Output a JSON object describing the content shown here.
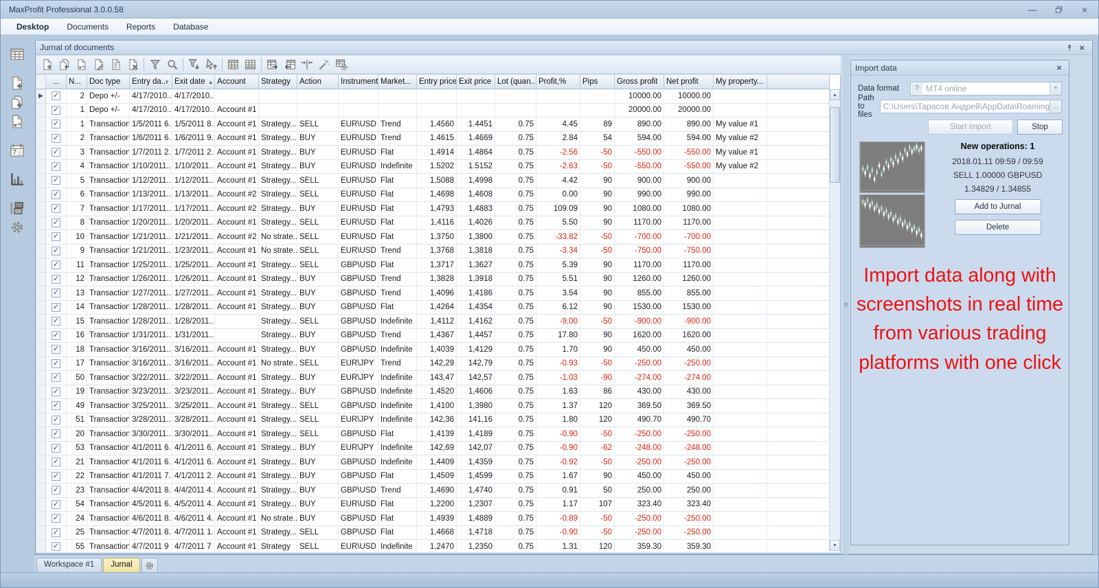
{
  "window": {
    "title": "MaxProfit Professional 3.0.0.58"
  },
  "menu": {
    "items": [
      "Desktop",
      "Documents",
      "Reports",
      "Database"
    ]
  },
  "sidebar": {
    "icons": [
      "journal-grid-icon",
      "new-document-icon",
      "copy-documents-icon",
      "transfer-documents-icon",
      "calendar-icon",
      "statistics-icon",
      "database-icon",
      "settings-icon"
    ]
  },
  "panel": {
    "title": "Jurnal of documents"
  },
  "toolbar": {
    "icons": [
      "add-document-icon",
      "copy-document-icon",
      "transfer-document-icon",
      "edit-document-icon",
      "view-document-icon",
      "delete-document-icon",
      "|",
      "filter-icon",
      "search-icon",
      "|",
      "filter-export-icon",
      "pointer-import-icon",
      "|",
      "group-table-icon",
      "summary-table-icon",
      "|",
      "export-table-icon",
      "import-table-icon",
      "best-fit-columns-icon",
      "wizard-icon",
      "grid-settings-icon"
    ]
  },
  "grid": {
    "columns": [
      {
        "label": "...",
        "align": "center"
      },
      {
        "label": "N...",
        "align": "right"
      },
      {
        "label": "Doc type",
        "align": "left"
      },
      {
        "label": "Entry da...",
        "align": "left",
        "filter": true
      },
      {
        "label": "Exit date",
        "align": "left",
        "sort": "asc"
      },
      {
        "label": "Account",
        "align": "left"
      },
      {
        "label": "Strategy",
        "align": "left"
      },
      {
        "label": "Action",
        "align": "left"
      },
      {
        "label": "Instrument",
        "align": "left"
      },
      {
        "label": "Market...",
        "align": "left"
      },
      {
        "label": "Entry price",
        "align": "right"
      },
      {
        "label": "Exit price",
        "align": "right"
      },
      {
        "label": "Lot (quan...",
        "align": "right"
      },
      {
        "label": "Profit,%",
        "align": "right"
      },
      {
        "label": "Pips",
        "align": "right"
      },
      {
        "label": "Gross profit",
        "align": "right"
      },
      {
        "label": "Net profit",
        "align": "right"
      },
      {
        "label": "My property...",
        "align": "left"
      }
    ],
    "rows": [
      [
        "2",
        "Depo +/-",
        "4/17/2010...",
        "4/17/2010...",
        "",
        "",
        "",
        "",
        "",
        "",
        "",
        "",
        "",
        "",
        "10000.00",
        "10000.00",
        ""
      ],
      [
        "1",
        "Depo +/-",
        "4/17/2010...",
        "4/17/2010...",
        "Account #1",
        "",
        "",
        "",
        "",
        "",
        "",
        "",
        "",
        "",
        "20000.00",
        "20000.00",
        ""
      ],
      [
        "1",
        "Transaction",
        "1/5/2011 6...",
        "1/5/2011 8...",
        "Account #1",
        "Strategy...",
        "SELL",
        "EUR\\USD",
        "Trend",
        "1.4560",
        "1.4451",
        "0.75",
        "4.45",
        "89",
        "890.00",
        "890.00",
        "My value #1"
      ],
      [
        "2",
        "Transaction",
        "1/6/2011 6...",
        "1/6/2011 9...",
        "Account #1",
        "Strategy...",
        "BUY",
        "EUR\\USD",
        "Trend",
        "1.4615",
        "1.4669",
        "0.75",
        "2.84",
        "54",
        "594.00",
        "594.00",
        "My value #2"
      ],
      [
        "3",
        "Transaction",
        "1/7/2011 2...",
        "1/7/2011 2...",
        "Account #1",
        "Strategy...",
        "BUY",
        "EUR\\USD",
        "Flat",
        "1.4914",
        "1.4864",
        "0.75",
        "-2.56",
        "-50",
        "-550.00",
        "-550.00",
        "My value #1"
      ],
      [
        "4",
        "Transaction",
        "1/10/2011...",
        "1/10/2011...",
        "Account #1",
        "Strategy...",
        "BUY",
        "EUR\\USD",
        "Indefinite",
        "1.5202",
        "1.5152",
        "0.75",
        "-2.63",
        "-50",
        "-550.00",
        "-550.00",
        "My value #2"
      ],
      [
        "5",
        "Transaction",
        "1/12/2011...",
        "1/12/2011...",
        "Account #1",
        "Strategy...",
        "SELL",
        "EUR\\USD",
        "Flat",
        "1,5088",
        "1,4998",
        "0.75",
        "4.42",
        "90",
        "900.00",
        "900.00",
        ""
      ],
      [
        "6",
        "Transaction",
        "1/13/2011...",
        "1/13/2011...",
        "Account #2",
        "Strategy...",
        "SELL",
        "EUR\\USD",
        "Flat",
        "1,4698",
        "1,4608",
        "0.75",
        "0.00",
        "90",
        "990.00",
        "990.00",
        ""
      ],
      [
        "7",
        "Transaction",
        "1/17/2011...",
        "1/17/2011...",
        "Account #2",
        "Strategy...",
        "BUY",
        "EUR\\USD",
        "Flat",
        "1,4793",
        "1,4883",
        "0.75",
        "109.09",
        "90",
        "1080.00",
        "1080.00",
        ""
      ],
      [
        "8",
        "Transaction",
        "1/20/2011...",
        "1/20/2011...",
        "Account #1",
        "Strategy...",
        "SELL",
        "EUR\\USD",
        "Flat",
        "1,4116",
        "1,4026",
        "0.75",
        "5.50",
        "90",
        "1170.00",
        "1170.00",
        ""
      ],
      [
        "10",
        "Transaction",
        "1/21/2011...",
        "1/21/2011...",
        "Account #2",
        "No strate...",
        "SELL",
        "EUR\\USD",
        "Flat",
        "1,3750",
        "1,3800",
        "0.75",
        "-33.82",
        "-50",
        "-700.00",
        "-700.00",
        ""
      ],
      [
        "9",
        "Transaction",
        "1/21/2011...",
        "1/23/2011...",
        "Account #1",
        "No strate...",
        "SELL",
        "EUR\\USD",
        "Trend",
        "1,3768",
        "1,3818",
        "0.75",
        "-3.34",
        "-50",
        "-750.00",
        "-750.00",
        ""
      ],
      [
        "11",
        "Transaction",
        "1/25/2011...",
        "1/25/2011...",
        "Account #1",
        "Strategy...",
        "SELL",
        "GBP\\USD",
        "Flat",
        "1,3717",
        "1,3627",
        "0.75",
        "5.39",
        "90",
        "1170.00",
        "1170.00",
        ""
      ],
      [
        "12",
        "Transaction",
        "1/26/2011...",
        "1/26/2011...",
        "Account #1",
        "Strategy...",
        "BUY",
        "GBP\\USD",
        "Trend",
        "1,3828",
        "1,3918",
        "0.75",
        "5.51",
        "90",
        "1260.00",
        "1260.00",
        ""
      ],
      [
        "13",
        "Transaction",
        "1/27/2011...",
        "1/27/2011...",
        "Account #1",
        "Strategy...",
        "BUY",
        "GBP\\USD",
        "Trend",
        "1,4096",
        "1,4186",
        "0.75",
        "3.54",
        "90",
        "855.00",
        "855.00",
        ""
      ],
      [
        "14",
        "Transaction",
        "1/28/2011...",
        "1/28/2011...",
        "Account #1",
        "Strategy...",
        "BUY",
        "GBP\\USD",
        "Flat",
        "1,4264",
        "1,4354",
        "0.75",
        "6.12",
        "90",
        "1530.00",
        "1530.00",
        ""
      ],
      [
        "15",
        "Transaction",
        "1/28/2011...",
        "1/28/2011...",
        "",
        "Strategy...",
        "SELL",
        "GBP\\USD",
        "Indefinite",
        "1,4112",
        "1,4162",
        "0.75",
        "-9.00",
        "-50",
        "-900.00",
        "-900.00",
        ""
      ],
      [
        "16",
        "Transaction",
        "1/31/2011...",
        "1/31/2011...",
        "",
        "Strategy...",
        "BUY",
        "GBP\\USD",
        "Trend",
        "1,4367",
        "1,4457",
        "0.75",
        "17.80",
        "90",
        "1620.00",
        "1620.00",
        ""
      ],
      [
        "18",
        "Transaction",
        "3/16/2011...",
        "3/16/2011...",
        "Account #1",
        "Strategy...",
        "BUY",
        "GBP\\USD",
        "Indefinite",
        "1,4039",
        "1,4129",
        "0.75",
        "1.70",
        "90",
        "450.00",
        "450.00",
        ""
      ],
      [
        "17",
        "Transaction",
        "3/16/2011...",
        "3/16/2011...",
        "Account #1",
        "No strate...",
        "SELL",
        "EUR\\JPY",
        "Trend",
        "142,29",
        "142,79",
        "0.75",
        "-0.93",
        "-50",
        "-250.00",
        "-250.00",
        ""
      ],
      [
        "50",
        "Transaction",
        "3/22/2011...",
        "3/22/2011...",
        "Account #1",
        "Strategy...",
        "BUY",
        "EUR\\JPY",
        "Indefinite",
        "143,47",
        "142,57",
        "0.75",
        "-1.03",
        "-90",
        "-274.00",
        "-274.00",
        ""
      ],
      [
        "19",
        "Transaction",
        "3/23/2011...",
        "3/23/2011...",
        "Account #1",
        "Strategy...",
        "BUY",
        "GBP\\USD",
        "Indefinite",
        "1,4520",
        "1,4606",
        "0.75",
        "1.63",
        "86",
        "430.00",
        "430.00",
        ""
      ],
      [
        "49",
        "Transaction",
        "3/25/2011...",
        "3/25/2011...",
        "Account #1",
        "Strategy...",
        "SELL",
        "GBP\\USD",
        "Indefinite",
        "1,4100",
        "1,3980",
        "0.75",
        "1.37",
        "120",
        "369.50",
        "369.50",
        ""
      ],
      [
        "51",
        "Transaction",
        "3/28/2011...",
        "3/28/2011...",
        "Account #1",
        "Strategy...",
        "SELL",
        "EUR\\JPY",
        "Indefinite",
        "142,36",
        "141,16",
        "0.75",
        "1.80",
        "120",
        "490.70",
        "490.70",
        ""
      ],
      [
        "20",
        "Transaction",
        "3/30/2011...",
        "3/30/2011...",
        "Account #1",
        "Strategy...",
        "SELL",
        "GBP\\USD",
        "Flat",
        "1,4139",
        "1,4189",
        "0.75",
        "-0.90",
        "-50",
        "-250.00",
        "-250.00",
        ""
      ],
      [
        "53",
        "Transaction",
        "4/1/2011 6...",
        "4/1/2011 6...",
        "Account #1",
        "Strategy...",
        "BUY",
        "EUR\\JPY",
        "Indefinite",
        "142,69",
        "142,07",
        "0.75",
        "-0.90",
        "-62",
        "-248.00",
        "-248.00",
        ""
      ],
      [
        "21",
        "Transaction",
        "4/1/2011 6...",
        "4/1/2011 6...",
        "Account #1",
        "Strategy...",
        "BUY",
        "GBP\\USD",
        "Indefinite",
        "1,4409",
        "1,4359",
        "0.75",
        "-0.92",
        "-50",
        "-250.00",
        "-250.00",
        ""
      ],
      [
        "22",
        "Transaction",
        "4/1/2011 7...",
        "4/1/2011 2...",
        "Account #1",
        "Strategy...",
        "BUY",
        "GBP\\USD",
        "Flat",
        "1,4509",
        "1,4599",
        "0.75",
        "1.67",
        "90",
        "450.00",
        "450.00",
        ""
      ],
      [
        "23",
        "Transaction",
        "4/4/2011 8...",
        "4/4/2011 4...",
        "Account #1",
        "Strategy...",
        "BUY",
        "GBP\\USD",
        "Trend",
        "1,4690",
        "1,4740",
        "0.75",
        "0.91",
        "50",
        "250.00",
        "250.00",
        ""
      ],
      [
        "54",
        "Transaction",
        "4/5/2011 6...",
        "4/5/2011 4...",
        "Account #1",
        "Strategy...",
        "BUY",
        "EUR\\USD",
        "Flat",
        "1,2200",
        "1,2307",
        "0.75",
        "1.17",
        "107",
        "323.40",
        "323.40",
        ""
      ],
      [
        "24",
        "Transaction",
        "4/6/2011 8...",
        "4/6/2011 4...",
        "Account #1",
        "No strate...",
        "BUY",
        "GBP\\USD",
        "Flat",
        "1,4939",
        "1,4889",
        "0.75",
        "-0.89",
        "-50",
        "-250.00",
        "-250.00",
        ""
      ],
      [
        "25",
        "Transaction",
        "4/7/2011 8...",
        "4/7/2011 1...",
        "Account #1",
        "Strategy...",
        "SELL",
        "GBP\\USD",
        "Flat",
        "1,4668",
        "1,4718",
        "0.75",
        "-0.90",
        "-50",
        "-250.00",
        "-250.00",
        ""
      ],
      [
        "55",
        "Transaction",
        "4/7/2011 9",
        "4/7/2011 7",
        "Account #1",
        "Strategy",
        "SELL",
        "EUR\\USD",
        "Indefinite",
        "1,2470",
        "1,2350",
        "0.75",
        "1.31",
        "120",
        "359.30",
        "359.30",
        ""
      ]
    ]
  },
  "import_panel": {
    "title": "Import data",
    "data_format_label": "Data format",
    "data_format_value": "MT4 online",
    "path_label": "Path to files",
    "path_value": "C:\\Users\\Тарасов Андрей\\AppData\\Roaming",
    "start_button": "Start import",
    "stop_button": "Stop",
    "new_operations": "New operations: 1",
    "operation_lines": [
      "2018.01.11 09:59 / 09:59",
      "SELL 1.00000 GBPUSD",
      "1.34829 / 1.34855"
    ],
    "add_button": "Add to Jurnal",
    "delete_button": "Delete",
    "marketing_text": "Import data along with screenshots in real time from various trading platforms with one click"
  },
  "tabs": {
    "items": [
      {
        "label": "Workspace #1",
        "active": false
      },
      {
        "label": "Jurnal",
        "active": true
      }
    ]
  },
  "colors": {
    "negative_value": "#dd2211",
    "marketing_text": "#ee1111",
    "active_tab": "#efe3a0",
    "panel_blue": "#ccdbec"
  }
}
